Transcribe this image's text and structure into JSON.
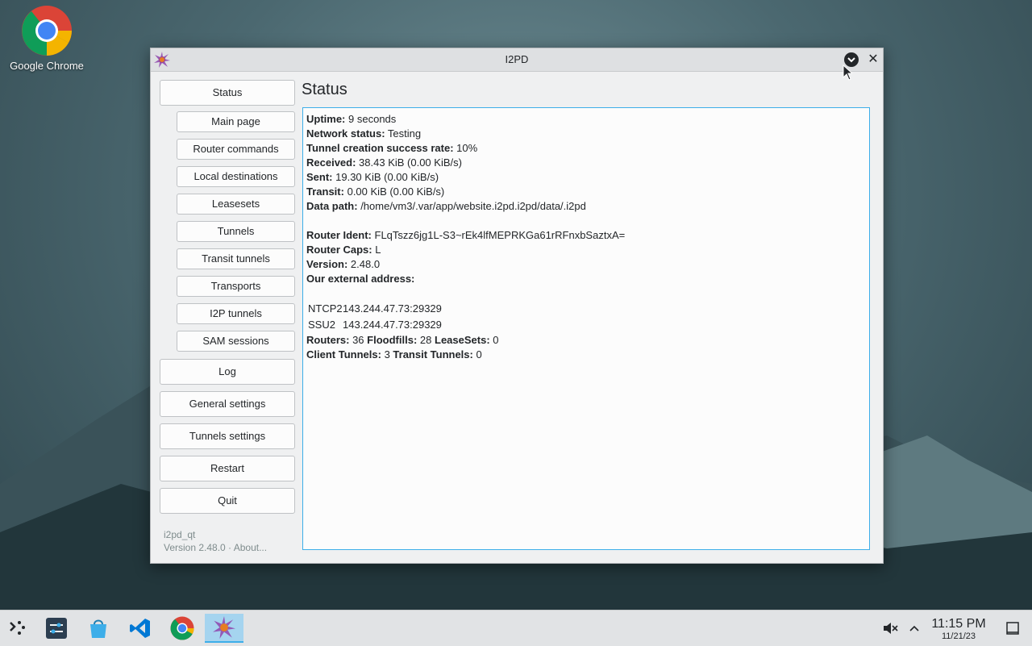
{
  "desktop": {
    "icons": [
      {
        "label": "Google Chrome",
        "icon": "chrome-icon"
      }
    ]
  },
  "window": {
    "title": "I2PD",
    "app_icon": "i2pd-icon",
    "controls": {
      "minimize": "chevron-down-circle-icon",
      "close": "✕"
    }
  },
  "sidebar": {
    "status": "Status",
    "sub_items": [
      "Main page",
      "Router commands",
      "Local destinations",
      "Leasesets",
      "Tunnels",
      "Transit tunnels",
      "Transports",
      "I2P tunnels",
      "SAM sessions"
    ],
    "log": "Log",
    "general_settings": "General settings",
    "tunnels_settings": "Tunnels settings",
    "restart": "Restart",
    "quit": "Quit",
    "app_name": "i2pd_qt",
    "version_line": "Version 2.48.0 · About..."
  },
  "main": {
    "heading": "Status",
    "status": {
      "uptime_label": "Uptime:",
      "uptime": "9 seconds",
      "network_label": "Network status:",
      "network": "Testing",
      "tcsr_label": "Tunnel creation success rate:",
      "tcsr": "10%",
      "received_label": "Received:",
      "received": "38.43 KiB (0.00 KiB/s)",
      "sent_label": "Sent:",
      "sent": "19.30 KiB (0.00 KiB/s)",
      "transit_label": "Transit:",
      "transit": "0.00 KiB (0.00 KiB/s)",
      "datapath_label": "Data path:",
      "datapath": "/home/vm3/.var/app/website.i2pd.i2pd/data/.i2pd",
      "ident_label": "Router Ident:",
      "ident": "FLqTszz6jg1L-S3~rEk4lfMEPRKGa61rRFnxbSaztxA=",
      "caps_label": "Router Caps:",
      "caps": "L",
      "version_label": "Version:",
      "version": "2.48.0",
      "external_label": "Our external address:",
      "addresses": [
        {
          "proto": "NTCP2",
          "addr": "143.244.47.73:29329"
        },
        {
          "proto": "SSU2",
          "addr": "143.244.47.73:29329"
        }
      ],
      "routers_label": "Routers:",
      "routers": "36",
      "floodfills_label": "Floodfills:",
      "floodfills": "28",
      "leasesets_label": "LeaseSets:",
      "leasesets": "0",
      "client_tunnels_label": "Client Tunnels:",
      "client_tunnels": "3",
      "transit_tunnels_label": "Transit Tunnels:",
      "transit_tunnels": "0"
    }
  },
  "taskbar": {
    "items": [
      "application-launcher-icon",
      "system-settings-icon",
      "discover-store-icon",
      "vscode-icon",
      "chrome-icon",
      "i2pd-icon"
    ],
    "tray": [
      "muted-volume-icon",
      "chevron-up-icon"
    ],
    "clock_time": "11:15 PM",
    "clock_date": "11/21/23",
    "show_desktop": "show-desktop-icon"
  },
  "colors": {
    "accent": "#3daee9",
    "window_bg": "#eff0f1",
    "panel_bg": "#fcfcfc"
  }
}
